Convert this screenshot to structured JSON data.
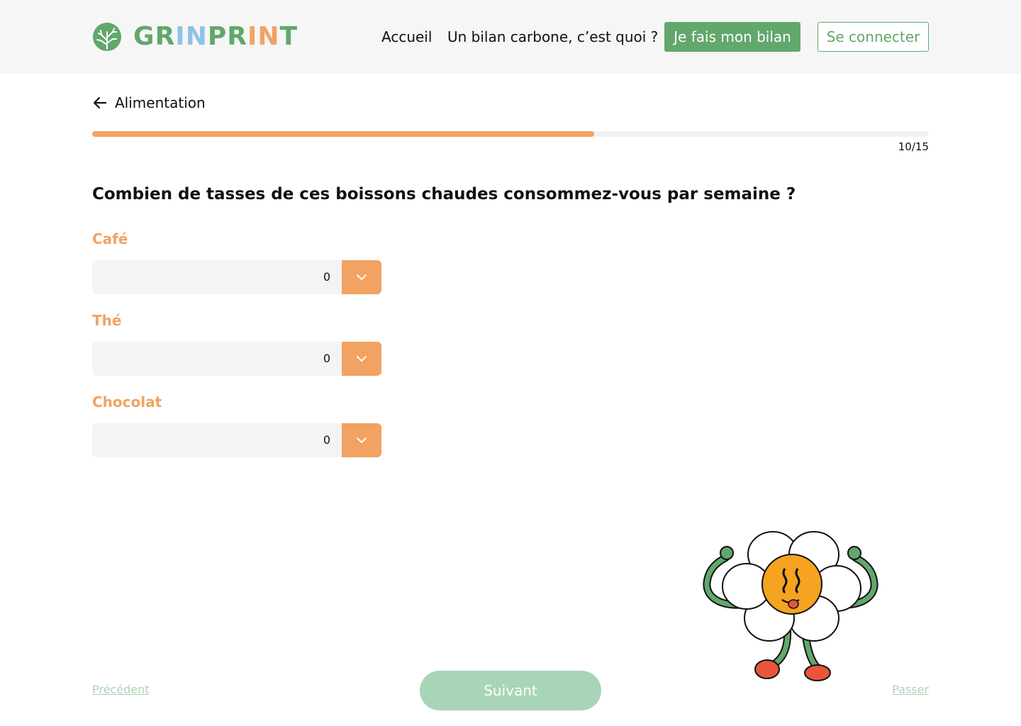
{
  "header": {
    "logo_text": "GRINPRINT",
    "logo_letters": [
      {
        "char": "G",
        "color": "#62a76c"
      },
      {
        "char": "R",
        "color": "#62a76c"
      },
      {
        "char": "I",
        "color": "#8ec3e6"
      },
      {
        "char": "N",
        "color": "#8ec3e6"
      },
      {
        "char": "P",
        "color": "#62a76c"
      },
      {
        "char": "R",
        "color": "#62a76c"
      },
      {
        "char": "I",
        "color": "#f2a261"
      },
      {
        "char": "N",
        "color": "#f2a261"
      },
      {
        "char": "T",
        "color": "#62a76c"
      }
    ],
    "nav": {
      "home": "Accueil",
      "about": "Un bilan carbone, c’est quoi ?",
      "start": "Je fais mon bilan",
      "login": "Se connecter"
    }
  },
  "section": {
    "back_label": "Alimentation"
  },
  "progress": {
    "current": 10,
    "total": 15,
    "fraction": 0.6,
    "label": "10/15"
  },
  "question": {
    "text": "Combien de tasses de ces boissons chaudes consommez-vous par semaine ?",
    "fields": [
      {
        "label": "Café",
        "value": "0"
      },
      {
        "label": "Thé",
        "value": "0"
      },
      {
        "label": "Chocolat",
        "value": "0"
      }
    ]
  },
  "footer": {
    "prev": "Précédent",
    "next": "Suivant",
    "skip": "Passer"
  },
  "colors": {
    "brand_green": "#62a76c",
    "accent_orange": "#f2a261",
    "light_green": "#a8d5b7",
    "logo_blue": "#8ec3e6"
  },
  "icons": {
    "logo": "tree-icon",
    "back": "arrow-left-icon",
    "dropdown": "chevron-down-icon",
    "mascot": "flower-mascot"
  }
}
